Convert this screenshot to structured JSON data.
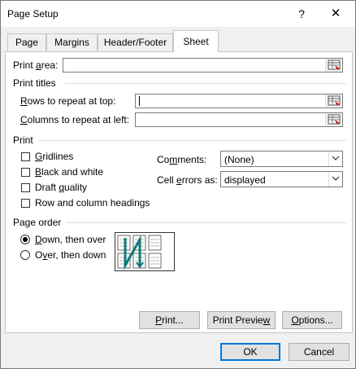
{
  "window": {
    "title": "Page Setup",
    "help": "?",
    "close": "✕"
  },
  "tabs": [
    {
      "label": "Page"
    },
    {
      "label": "Margins"
    },
    {
      "label": "Header/Footer"
    },
    {
      "label": "Sheet"
    }
  ],
  "print_area": {
    "pre": "Print ",
    "key": "a",
    "post": "rea:",
    "value": ""
  },
  "print_titles": {
    "heading": "Print titles",
    "rows": {
      "key": "R",
      "post": "ows to repeat at top:",
      "value": ""
    },
    "cols": {
      "key": "C",
      "post": "olumns to repeat at left:",
      "value": ""
    }
  },
  "print": {
    "heading": "Print",
    "gridlines": {
      "key": "G",
      "post": "ridlines",
      "checked": false
    },
    "bw": {
      "key": "B",
      "post": "lack and white",
      "checked": false
    },
    "draft": {
      "pre": "Draft ",
      "key": "q",
      "post": "uality",
      "checked": false
    },
    "rowcol": {
      "label": "Row and column headings",
      "checked": false
    },
    "comments": {
      "pre": "Co",
      "key": "m",
      "post": "ments:",
      "value": "(None)"
    },
    "errors": {
      "pre": "Cell ",
      "key": "e",
      "post": "rrors as:",
      "value": "displayed"
    }
  },
  "page_order": {
    "heading": "Page order",
    "down": {
      "key": "D",
      "post": "own, then over",
      "selected": true
    },
    "over": {
      "pre": "O",
      "key": "v",
      "post": "er, then down",
      "selected": false
    }
  },
  "buttons": {
    "print": {
      "pre": "",
      "key": "P",
      "post": "rint..."
    },
    "preview": {
      "pre": "Print Previe",
      "key": "w",
      "post": ""
    },
    "options": {
      "pre": "",
      "key": "O",
      "post": "ptions..."
    },
    "ok": "OK",
    "cancel": "Cancel"
  }
}
